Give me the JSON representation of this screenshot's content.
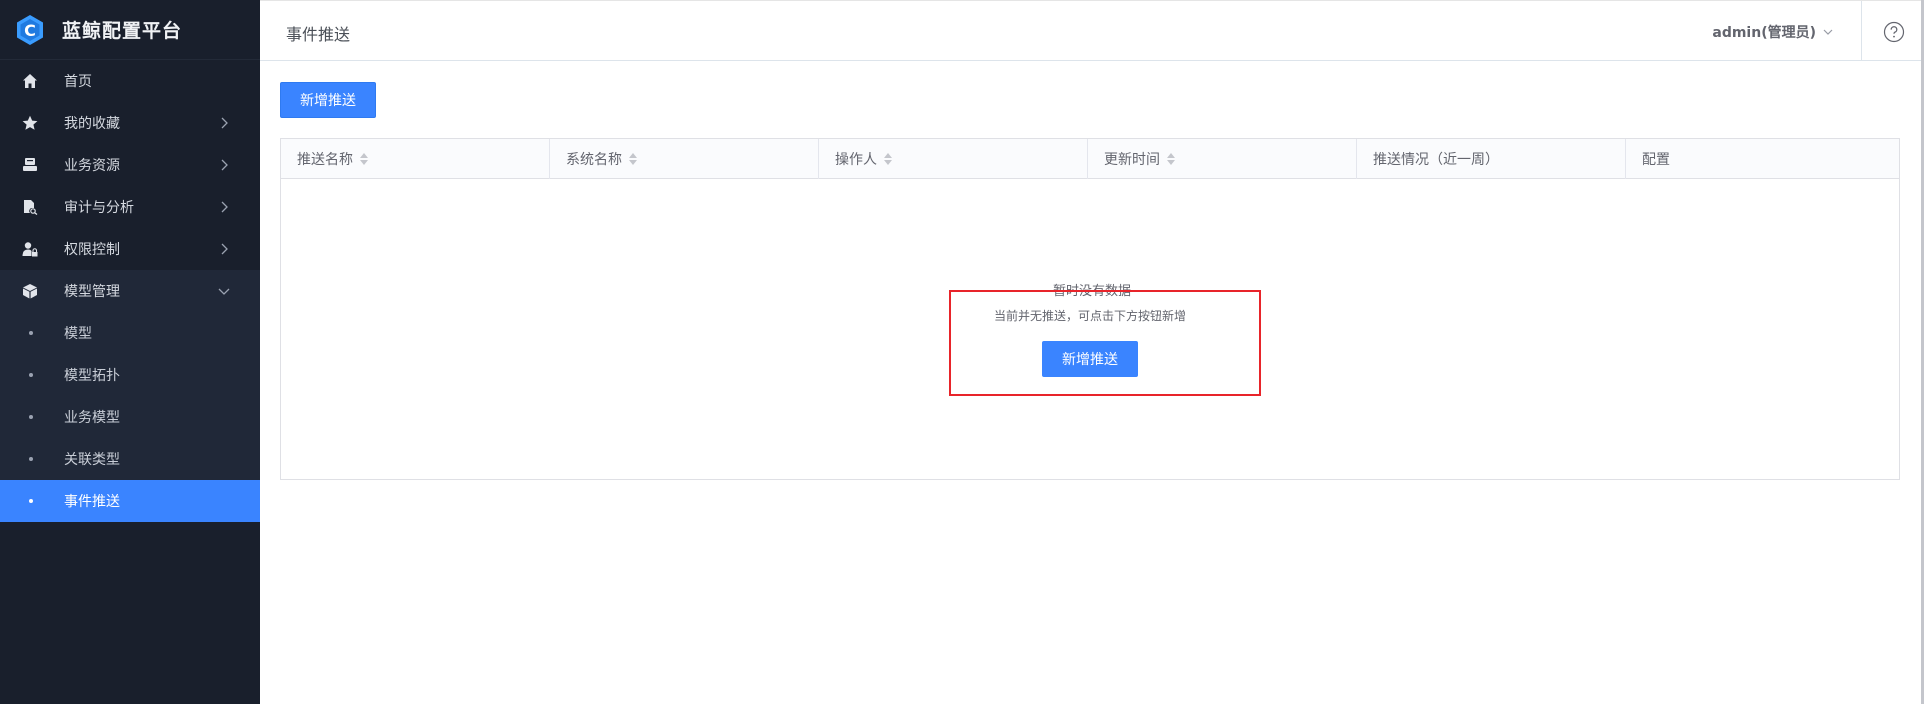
{
  "app": {
    "title": "蓝鲸配置平台"
  },
  "sidebar": {
    "items": [
      {
        "label": "首页",
        "icon": "home-icon"
      },
      {
        "label": "我的收藏",
        "icon": "star-icon"
      },
      {
        "label": "业务资源",
        "icon": "resource-icon"
      },
      {
        "label": "审计与分析",
        "icon": "audit-icon"
      },
      {
        "label": "权限控制",
        "icon": "user-lock-icon"
      },
      {
        "label": "模型管理",
        "icon": "cube-icon"
      }
    ],
    "sub_items": [
      {
        "label": "模型"
      },
      {
        "label": "模型拓扑"
      },
      {
        "label": "业务模型"
      },
      {
        "label": "关联类型"
      },
      {
        "label": "事件推送"
      }
    ]
  },
  "header": {
    "title": "事件推送",
    "user": "admin(管理员)"
  },
  "toolbar": {
    "add_label": "新增推送"
  },
  "table": {
    "columns": [
      "推送名称",
      "系统名称",
      "操作人",
      "更新时间",
      "推送情况（近一周）",
      "配置"
    ],
    "rows": []
  },
  "empty_state": {
    "title": "暂时没有数据",
    "description": "当前并无推送，可点击下方按钮新增",
    "button_label": "新增推送"
  },
  "colors": {
    "sidebar_bg": "#191f2c",
    "accent": "#3a84ff",
    "highlight": "#e8242a"
  }
}
